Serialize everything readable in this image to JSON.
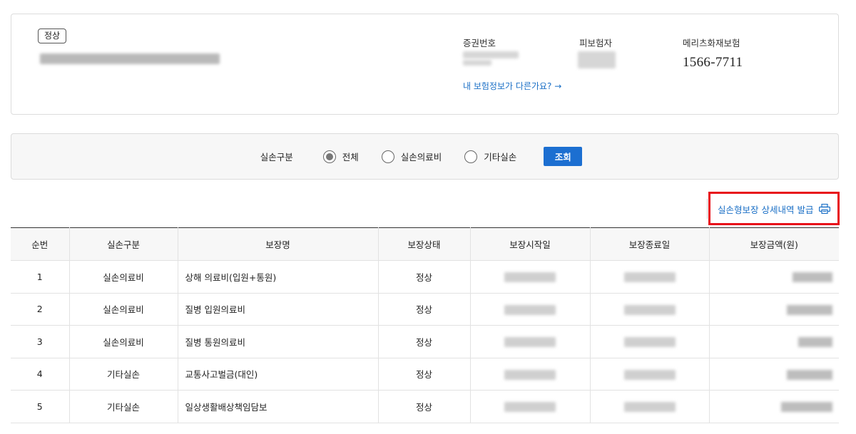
{
  "policy": {
    "status_badge": "정상",
    "cert_number_label": "증권번호",
    "insured_label": "피보험자",
    "insurer_label": "메리츠화재보험",
    "insurer_phone": "1566-7711",
    "info_link": "내 보험정보가 다른가요? →"
  },
  "filter": {
    "title": "실손구분",
    "options": [
      {
        "label": "전체",
        "checked": true
      },
      {
        "label": "실손의료비",
        "checked": false
      },
      {
        "label": "기타실손",
        "checked": false
      }
    ],
    "search_button": "조회"
  },
  "issue_button": {
    "label": "실손형보장 상세내역 발급",
    "icon": "printer-icon"
  },
  "table": {
    "headers": [
      "순번",
      "실손구분",
      "보장명",
      "보장상태",
      "보장시작일",
      "보장종료일",
      "보장금액(원)"
    ],
    "rows": [
      {
        "no": "1",
        "type": "실손의료비",
        "name": "상해 의료비(입원+통원)",
        "status": "정상"
      },
      {
        "no": "2",
        "type": "실손의료비",
        "name": "질병 입원의료비",
        "status": "정상"
      },
      {
        "no": "3",
        "type": "실손의료비",
        "name": "질병 통원의료비",
        "status": "정상"
      },
      {
        "no": "4",
        "type": "기타실손",
        "name": "교통사고벌금(대인)",
        "status": "정상"
      },
      {
        "no": "5",
        "type": "기타실손",
        "name": "일상생활배상책임담보",
        "status": "정상"
      }
    ]
  }
}
